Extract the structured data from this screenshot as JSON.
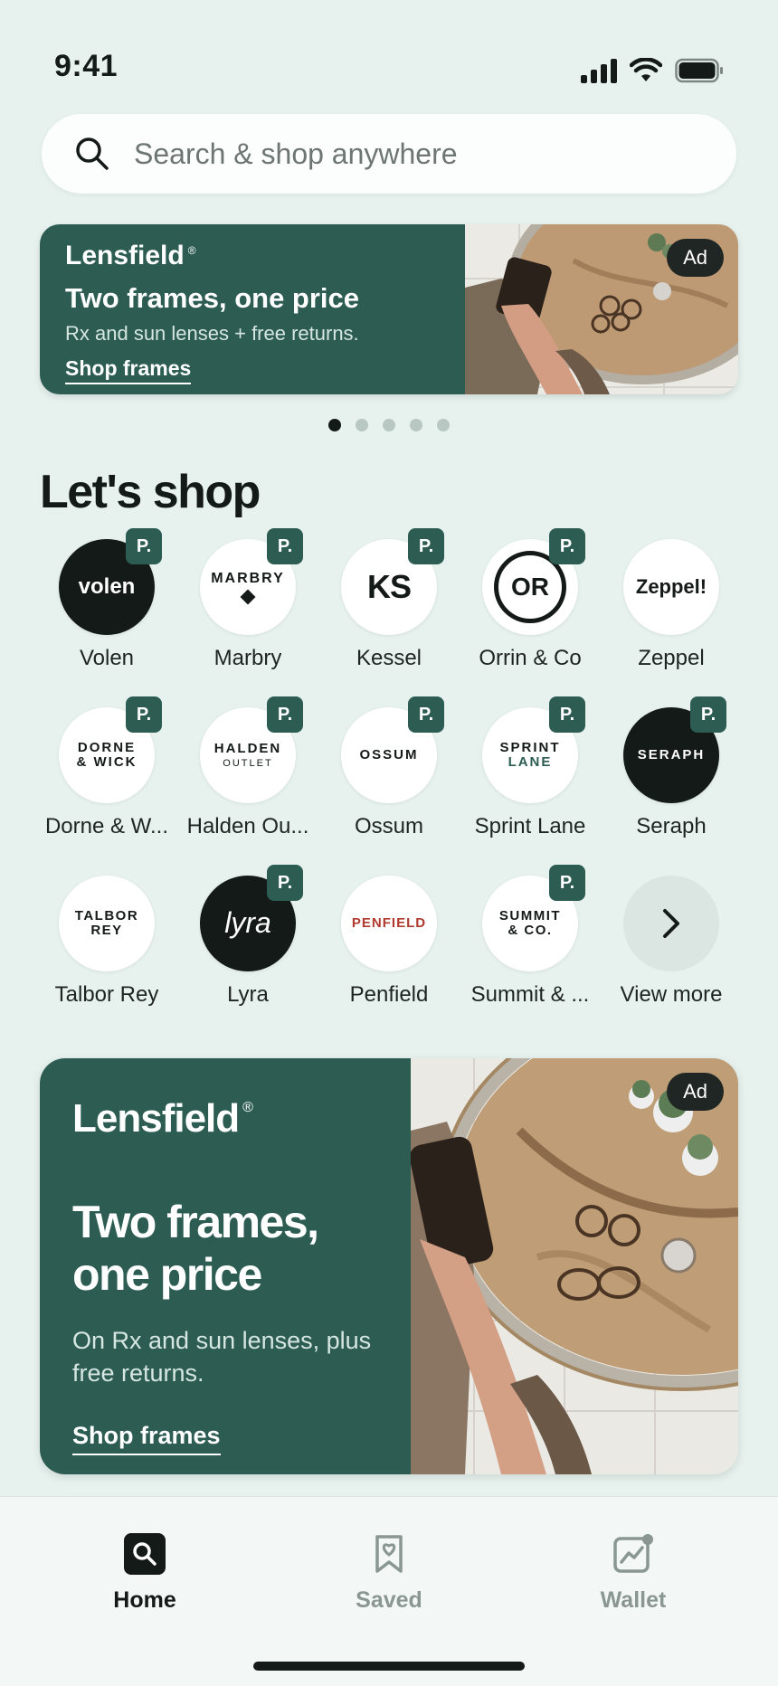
{
  "status": {
    "time": "9:41"
  },
  "search": {
    "placeholder": "Search & shop anywhere"
  },
  "banner_small": {
    "brand": "Lensfield",
    "registered": "®",
    "headline": "Two frames, one price",
    "sub": "Rx and sun lenses + free returns.",
    "cta": "Shop frames",
    "ad_label": "Ad"
  },
  "carousel": {
    "pages": 5,
    "active": 1
  },
  "section": {
    "title": "Let's shop"
  },
  "brands": [
    {
      "name": "Volen",
      "logo": "volen",
      "badge": "P."
    },
    {
      "name": "Marbry",
      "logo": "MARBRY",
      "badge": "P."
    },
    {
      "name": "Kessel",
      "logo": "KS",
      "badge": "P."
    },
    {
      "name": "Orrin & Co",
      "logo": "OR",
      "badge": "P."
    },
    {
      "name": "Zeppel",
      "logo": "Zeppel!",
      "badge": ""
    },
    {
      "name": "Dorne & W...",
      "logo": "DORNE & WICK",
      "badge": "P."
    },
    {
      "name": "Halden Ou...",
      "logo": "HALDEN",
      "logo_sub": "OUTLET",
      "badge": "P."
    },
    {
      "name": "Ossum",
      "logo": "OSSUM",
      "badge": "P."
    },
    {
      "name": "Sprint Lane",
      "logo": "SPRINT",
      "logo_sub": "LANE",
      "badge": "P."
    },
    {
      "name": "Seraph",
      "logo": "SERAPH",
      "badge": "P."
    },
    {
      "name": "Talbor Rey",
      "logo": "TALBOR REY",
      "badge": ""
    },
    {
      "name": "Lyra",
      "logo": "lyra",
      "badge": "P."
    },
    {
      "name": "Penfield",
      "logo": "PENFIELD",
      "badge": ""
    },
    {
      "name": "Summit & ...",
      "logo": "SUMMIT & CO.",
      "badge": "P."
    },
    {
      "name": "View more",
      "logo": "",
      "badge": ""
    }
  ],
  "banner_large": {
    "brand": "Lensfield",
    "registered": "®",
    "headline": "Two frames, one price",
    "sub": "On Rx and sun lenses, plus free returns.",
    "cta": "Shop frames",
    "ad_label": "Ad"
  },
  "tabs": [
    {
      "label": "Home",
      "icon": "search-icon"
    },
    {
      "label": "Saved",
      "icon": "bookmark-icon"
    },
    {
      "label": "Wallet",
      "icon": "wallet-chart-icon"
    }
  ],
  "colors": {
    "accent": "#2c5c52",
    "background": "#e7f2ee",
    "dark": "#141a18"
  }
}
